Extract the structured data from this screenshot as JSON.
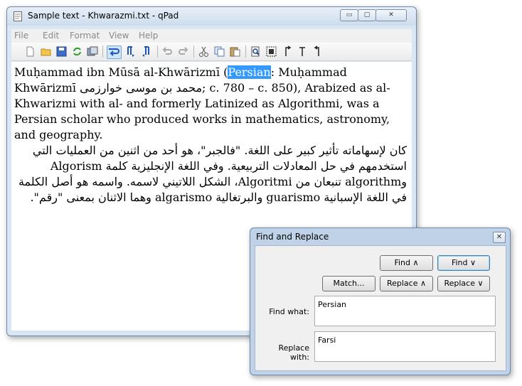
{
  "window": {
    "title": "Sample text - Khwarazmi.txt - qPad",
    "controls": {
      "minimize": "▭",
      "maximize": "▢",
      "close": "✕"
    }
  },
  "menu": [
    "File",
    "Edit",
    "Format",
    "View",
    "Help"
  ],
  "toolbar_icons": [
    "new-icon",
    "open-icon",
    "save-icon",
    "reload-icon",
    "save-all-icon",
    "word-wrap-icon",
    "ltr-icon",
    "rtl-icon",
    "undo-icon",
    "redo-icon",
    "cut-icon",
    "copy-icon",
    "paste-icon",
    "find-icon",
    "select-all-icon",
    "insert-lrm-icon",
    "insert-rlm-icon",
    "pilcrow-icon"
  ],
  "editor": {
    "p1_before": "Muḥammad ibn Mūsā al-Khwārizmī (",
    "p1_selected": "Persian",
    "p1_after": ": Muḥammad Khwārizmī ‎محمد بن موسی خوارزمی‎; c. 780 – c. 850), Arabized as al-Khwarizmi with al- and formerly Latinized as Algorithmi, was a Persian scholar who produced works in mathematics, astronomy, and geography.",
    "p2": "كان لإسهاماته تأثير كبير على اللغة. \"فالجبر\"، هو أحد من اثنين من العمليات التي استخدمهم في حل المعادلات التربيعية. وفي اللغة الإنجليزية كلمة Algorism وalgorithm تنبعان من Algoritmi، الشكل اللاتيني لاسمه. واسمه هو أصل الكلمة في اللغة الإسبانية guarismo والبرتغالية algarismo وهما الاثنان بمعنى \"رقم\"."
  },
  "find_dialog": {
    "title": "Find and Replace",
    "close": "✕",
    "buttons": {
      "find_up": "Find ∧",
      "find_down": "Find ∨",
      "match": "Match...",
      "replace_up": "Replace ∧",
      "replace_down": "Replace ∨"
    },
    "find_label": "Find what:",
    "find_value": "Persian",
    "replace_label": "Replace with:",
    "replace_value": "Farsi"
  }
}
